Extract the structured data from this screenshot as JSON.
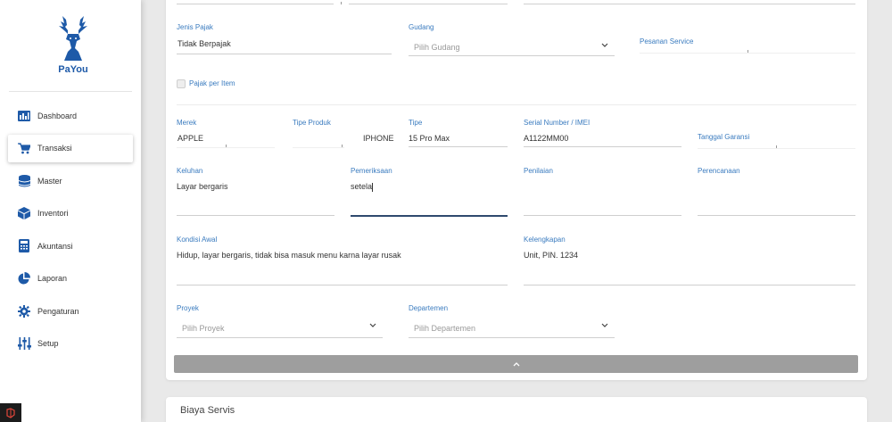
{
  "sidebar": {
    "logo": {
      "part1": "Pa",
      "part2": "You"
    },
    "items": [
      {
        "label": "Dashboard",
        "icon": "dashboard-icon",
        "active": false
      },
      {
        "label": "Transaksi",
        "icon": "cart-icon",
        "active": true
      },
      {
        "label": "Master",
        "icon": "database-icon",
        "active": false
      },
      {
        "label": "Inventori",
        "icon": "box-icon",
        "active": false
      },
      {
        "label": "Akuntansi",
        "icon": "calculator-icon",
        "active": false
      },
      {
        "label": "Laporan",
        "icon": "pie-chart-icon",
        "active": false
      },
      {
        "label": "Pengaturan",
        "icon": "gear-icon",
        "active": false
      },
      {
        "label": "Setup",
        "icon": "sliders-icon",
        "active": false
      }
    ]
  },
  "form": {
    "jenis_pajak": {
      "label": "Jenis Pajak",
      "value": "Tidak Berpajak"
    },
    "gudang": {
      "label": "Gudang",
      "placeholder": "Pilih Gudang"
    },
    "pesanan_service": {
      "label": "Pesanan Service",
      "value": ""
    },
    "pajak_per_item": {
      "label": "Pajak per Item",
      "checked": false
    },
    "merek": {
      "label": "Merek",
      "value": "APPLE"
    },
    "tipe_produk": {
      "label": "Tipe Produk",
      "value": "IPHONE"
    },
    "tipe": {
      "label": "Tipe",
      "value": "15 Pro Max"
    },
    "serial": {
      "label": "Serial Number / IMEI",
      "value": "A1122MM00"
    },
    "tanggal_garansi": {
      "label": "Tanggal Garansi",
      "value": ""
    },
    "keluhan": {
      "label": "Keluhan",
      "value": "Layar bergaris"
    },
    "pemeriksaan": {
      "label": "Pemeriksaan",
      "value": "setela"
    },
    "penilaian": {
      "label": "Penilaian",
      "value": ""
    },
    "perencanaan": {
      "label": "Perencanaan",
      "value": ""
    },
    "kondisi_awal": {
      "label": "Kondisi Awal",
      "value": "Hidup, layar bergaris, tidak bisa masuk menu karna layar rusak"
    },
    "kelengkapan": {
      "label": "Kelengkapan",
      "value": "Unit, PIN. 1234"
    },
    "proyek": {
      "label": "Proyek",
      "placeholder": "Pilih Proyek"
    },
    "departemen": {
      "label": "Departemen",
      "placeholder": "Pilih Departemen"
    }
  },
  "biaya_servis": {
    "title": "Biaya Servis"
  },
  "colors": {
    "accent": "#3a7bbf",
    "brand": "#1e5aa8",
    "collapse_bar": "#9e9e9e"
  }
}
